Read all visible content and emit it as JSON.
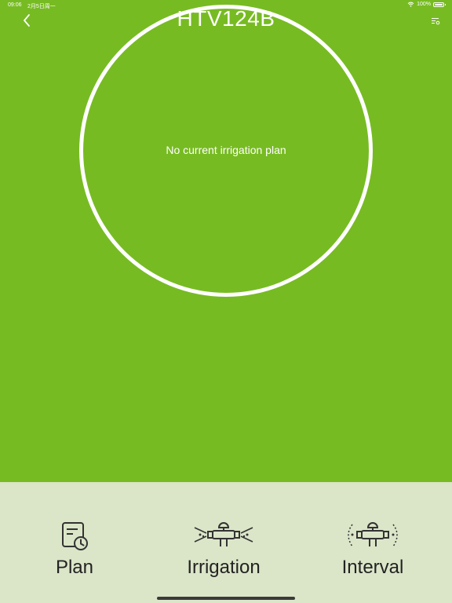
{
  "status_bar": {
    "time": "09:06",
    "date": "2月5日周一",
    "battery": "100%"
  },
  "header": {
    "title": "HTV124B"
  },
  "status": {
    "message": "No current irrigation plan"
  },
  "actions": [
    {
      "label": "Plan",
      "icon": "plan-clock-icon"
    },
    {
      "label": "Irrigation",
      "icon": "sprinkler-irrigation-icon"
    },
    {
      "label": "Interval",
      "icon": "sprinkler-interval-icon"
    }
  ],
  "colors": {
    "background": "#77bb22",
    "panel": "#dbe5c8",
    "text_dark": "#222222",
    "text_light": "#ffffff"
  }
}
